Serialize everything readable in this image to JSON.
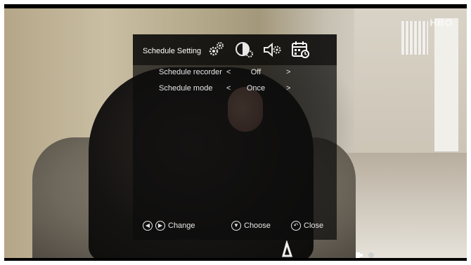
{
  "channel": {
    "logo_text": "HBO"
  },
  "osd": {
    "title": "Schedule Setting",
    "tabs": [
      {
        "icon": "settings-gears-icon"
      },
      {
        "icon": "display-settings-icon"
      },
      {
        "icon": "audio-settings-icon"
      },
      {
        "icon": "schedule-calendar-icon",
        "active": true
      }
    ],
    "settings": [
      {
        "label": "Schedule recorder",
        "arrow_left": "<",
        "value": "Off",
        "arrow_right": ">"
      },
      {
        "label": "Schedule mode",
        "arrow_left": "<",
        "value": "Once",
        "arrow_right": ">"
      }
    ],
    "hints": {
      "change": "Change",
      "choose": "Choose",
      "close": "Close"
    }
  },
  "colors": {
    "osd_background": "#0c0c0c",
    "osd_text": "#e6e6e6",
    "title_text": "#ffffff"
  }
}
